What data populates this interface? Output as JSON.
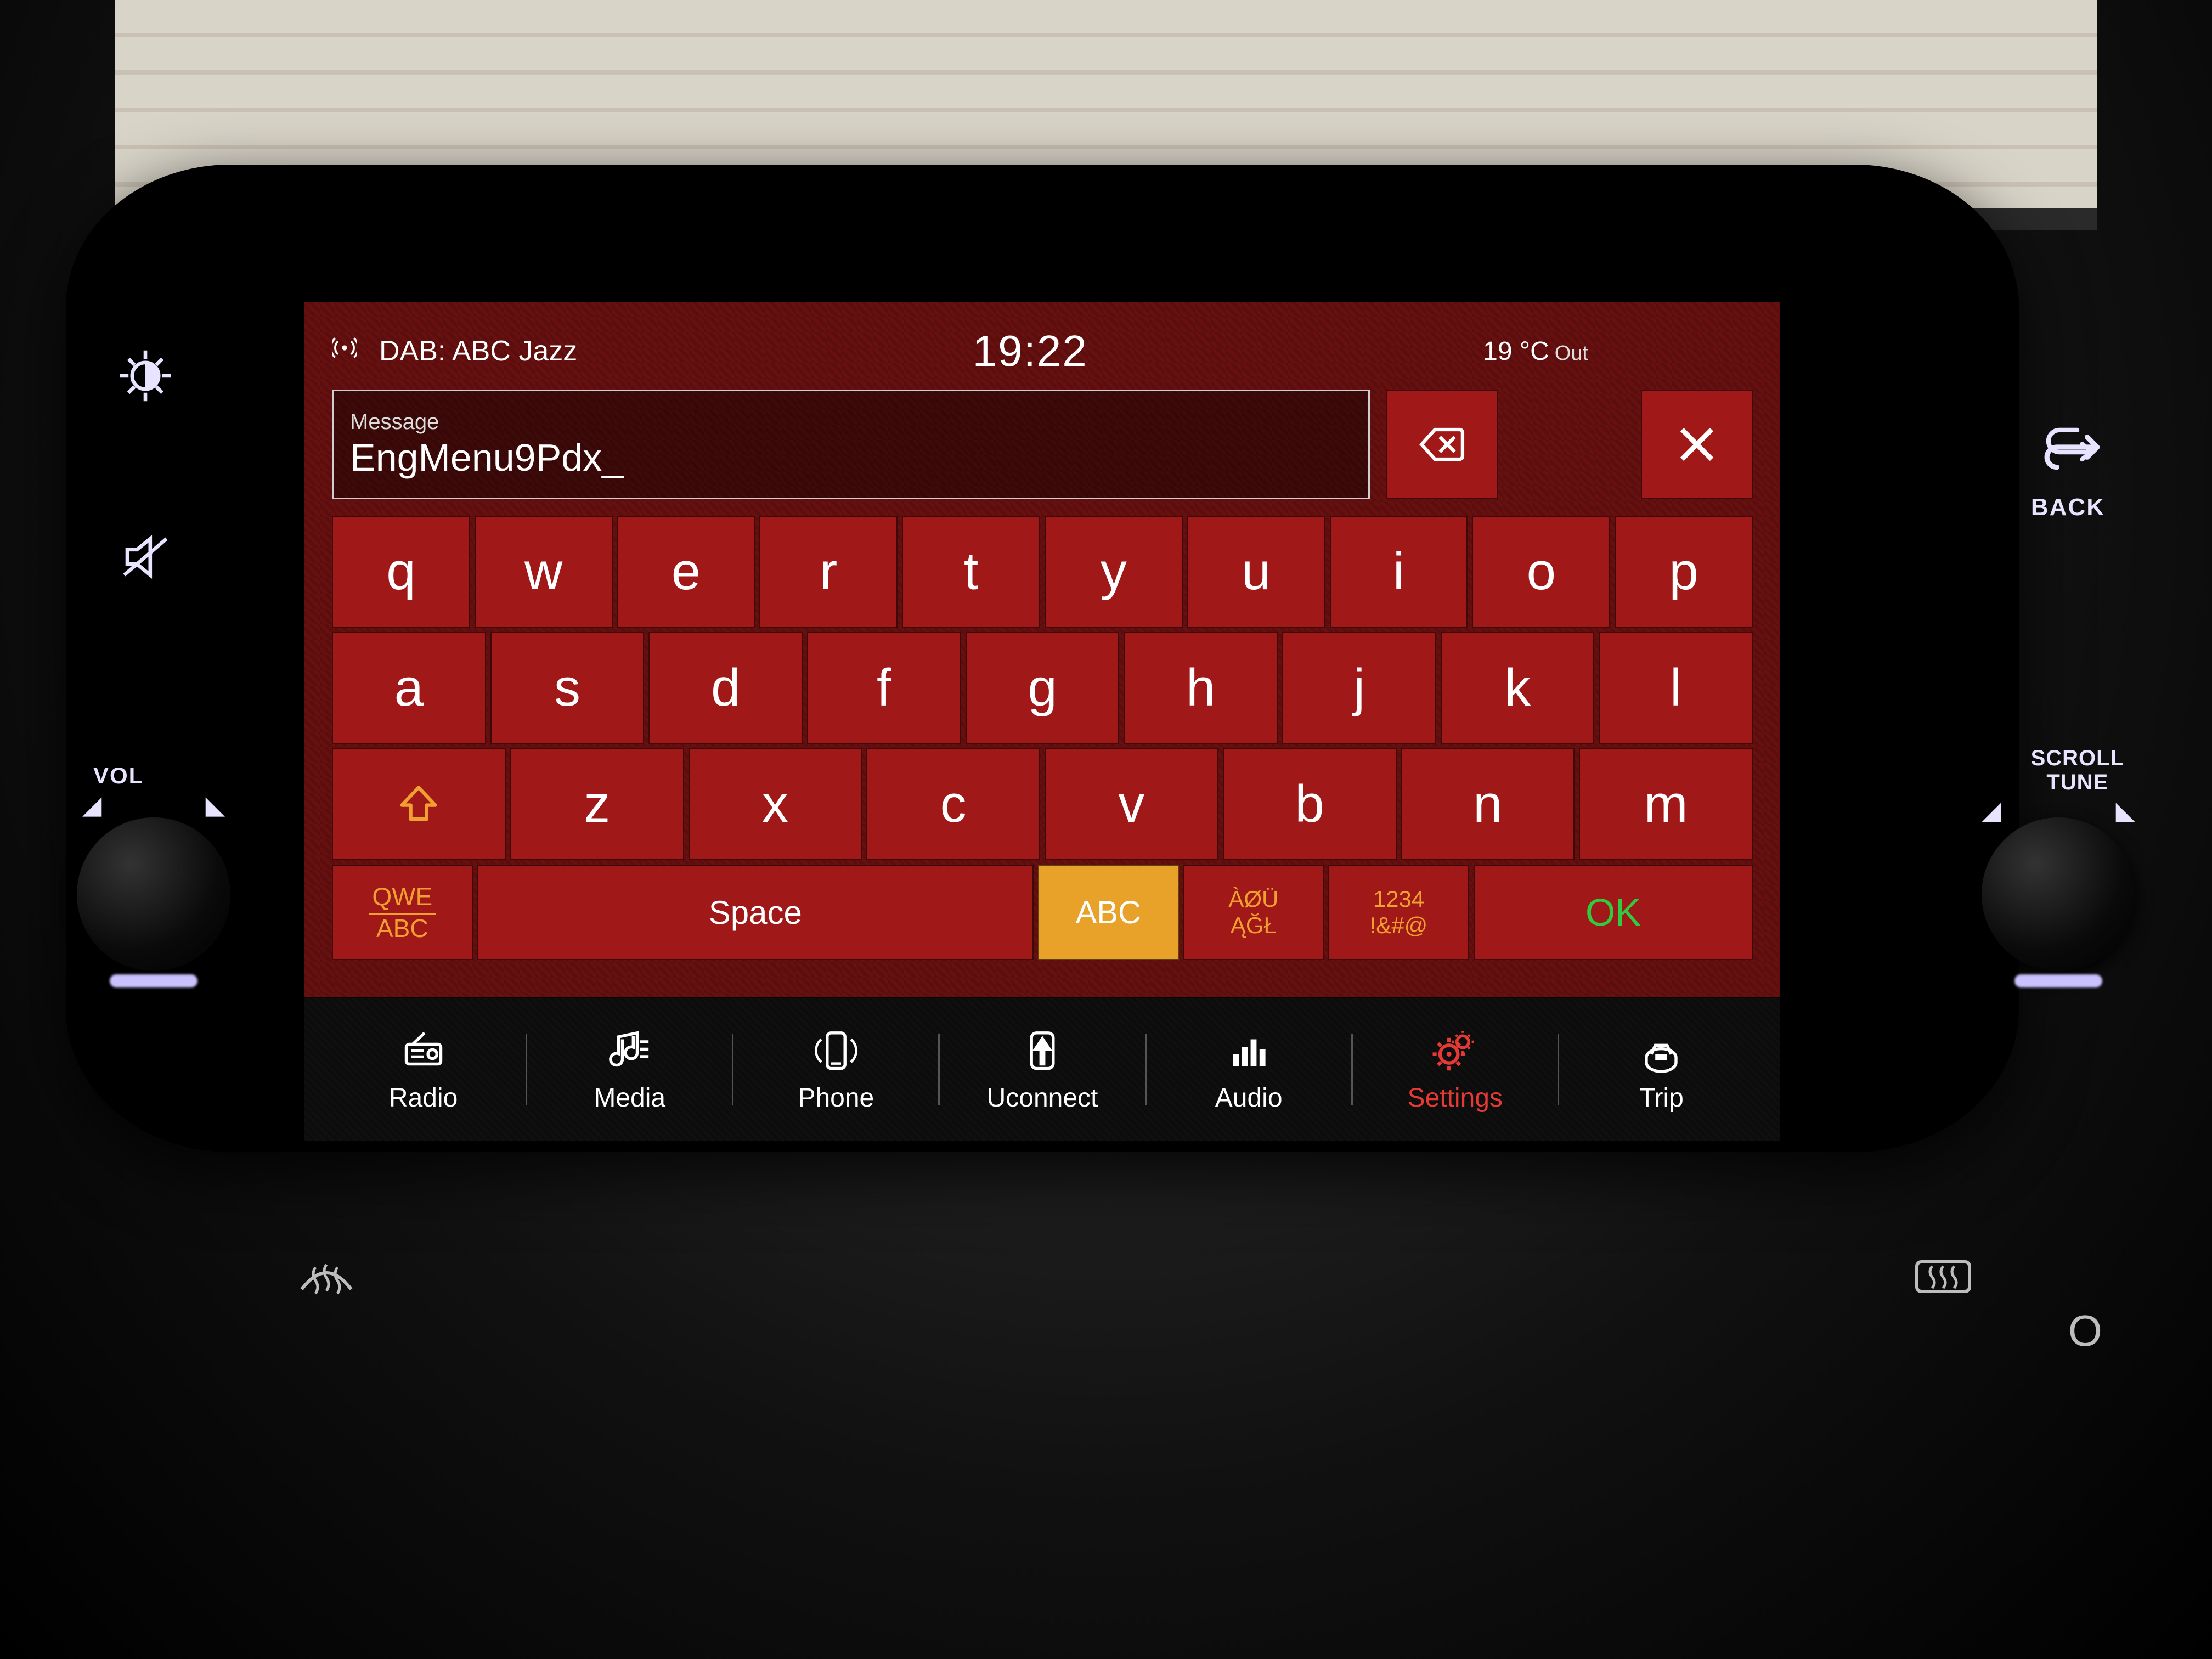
{
  "status": {
    "source_prefix": "DAB:",
    "source_name": "ABC Jazz",
    "clock": "19:22",
    "temperature": "19 °C",
    "temp_suffix": "Out"
  },
  "input": {
    "label": "Message",
    "value": "EngMenu9Pdx_"
  },
  "keyboard": {
    "row1": [
      "q",
      "w",
      "e",
      "r",
      "t",
      "y",
      "u",
      "i",
      "o",
      "p"
    ],
    "row2": [
      "a",
      "s",
      "d",
      "f",
      "g",
      "h",
      "j",
      "k",
      "l"
    ],
    "row3": [
      "z",
      "x",
      "c",
      "v",
      "b",
      "n",
      "m"
    ],
    "mode_top": "QWE",
    "mode_bottom": "ABC",
    "space": "Space",
    "abc": "ABC",
    "diac_top": "ÀØÜ",
    "diac_bottom": "ĄĞŁ",
    "sym_top": "1234",
    "sym_bottom": "!&#@",
    "ok": "OK"
  },
  "nav": {
    "items": [
      {
        "label": "Radio",
        "icon": "radio"
      },
      {
        "label": "Media",
        "icon": "media"
      },
      {
        "label": "Phone",
        "icon": "phone"
      },
      {
        "label": "Uconnect",
        "icon": "uconnect"
      },
      {
        "label": "Audio",
        "icon": "audio"
      },
      {
        "label": "Settings",
        "icon": "settings",
        "active": true
      },
      {
        "label": "Trip",
        "icon": "trip"
      }
    ]
  },
  "bezel": {
    "back": "BACK",
    "vol": "VOL",
    "scroll_top": "SCROLL",
    "scroll_bottom": "TUNE"
  }
}
